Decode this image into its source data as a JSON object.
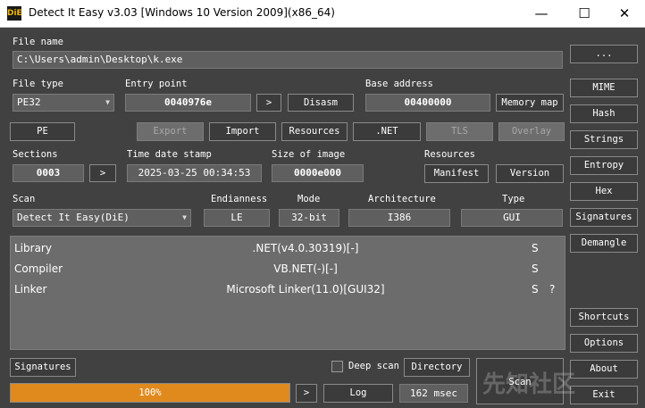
{
  "window": {
    "title": "Detect It Easy v3.03 [Windows 10 Version 2009](x86_64)",
    "icon_text": "DiE",
    "controls": {
      "minimize": "—",
      "maximize": "☐",
      "close": "✕"
    }
  },
  "file": {
    "label": "File name",
    "path": "C:\\Users\\admin\\Desktop\\k.exe",
    "browse_label": "..."
  },
  "file_type": {
    "label": "File type",
    "value": "PE32"
  },
  "entry_point": {
    "label": "Entry point",
    "value": "0040976e",
    "go_label": ">",
    "disasm_label": "Disasm"
  },
  "base_address": {
    "label": "Base address",
    "value": "00400000",
    "memory_map_label": "Memory map"
  },
  "toolbar": {
    "pe": "PE",
    "export": "Export",
    "import": "Import",
    "resources": "Resources",
    "net": ".NET",
    "tls": "TLS",
    "overlay": "Overlay"
  },
  "sections": {
    "label": "Sections",
    "value": "0003",
    "go_label": ">"
  },
  "timestamp": {
    "label": "Time date stamp",
    "value": "2025-03-25 00:34:53"
  },
  "size_of_image": {
    "label": "Size of image",
    "value": "0000e000"
  },
  "resources": {
    "label": "Resources",
    "manifest": "Manifest",
    "version": "Version"
  },
  "scan_row": {
    "scan_label": "Scan",
    "engine": "Detect It Easy(DiE)",
    "endianness_label": "Endianness",
    "endianness": "LE",
    "mode_label": "Mode",
    "mode": "32-bit",
    "arch_label": "Architecture",
    "arch": "I386",
    "type_label": "Type",
    "type": "GUI"
  },
  "results": [
    {
      "kind": "Library",
      "name": ".NET(v4.0.30319)[-]",
      "flag": "S",
      "extra": ""
    },
    {
      "kind": "Compiler",
      "name": "VB.NET(-)[-]",
      "flag": "S",
      "extra": ""
    },
    {
      "kind": "Linker",
      "name": "Microsoft Linker(11.0)[GUI32]",
      "flag": "S",
      "extra": "?"
    }
  ],
  "side": {
    "mime": "MIME",
    "hash": "Hash",
    "strings": "Strings",
    "entropy": "Entropy",
    "hex": "Hex",
    "signatures": "Signatures",
    "demangle": "Demangle",
    "shortcuts": "Shortcuts",
    "options": "Options",
    "about": "About",
    "exit": "Exit"
  },
  "bottom": {
    "signatures": "Signatures",
    "deep_scan_label": "Deep scan",
    "deep_scan_checked": false,
    "directory": "Directory",
    "scan": "Scan",
    "progress_text": "100%",
    "progress_value": 100,
    "go_label": ">",
    "log": "Log",
    "time": "162 msec"
  },
  "watermark": "先知社区",
  "colors": {
    "progress": "#e08a1e",
    "background": "#414141"
  }
}
